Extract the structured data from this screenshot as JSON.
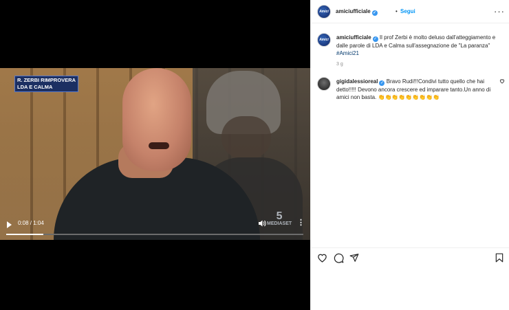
{
  "video": {
    "caption_line1": "R. ZERBI RIMPROVERA",
    "caption_line2": "LDA E CALMA",
    "time": "0:08 / 1:04",
    "progress": 0.125,
    "watermark": "MEDIASET",
    "watermark_num": "5"
  },
  "post": {
    "username": "amiciufficiale",
    "follow_label": "Segui",
    "dot": "•",
    "caption": "Il prof Zerbi è molto deluso dall'atteggiamento e dalle parole di LDA e Calma sull'assegnazione de \"La paranza\"",
    "hashtag": "#Amici21",
    "age": "3 g",
    "avatar_text": "Amici"
  },
  "comments": [
    {
      "username": "gigidalessioreal",
      "text": "Bravo Rudi!!!Condivi tutto quello che hai detto!!!!! Devono ancora crescere ed imparare tanto.Un anno di amici non basta. 👏👏👏👏👏👏👏👏👏"
    }
  ],
  "icons": {
    "like": "heart-icon",
    "comment": "comment-icon",
    "share": "share-icon",
    "save": "bookmark-icon",
    "more": "more-icon",
    "play": "play-icon",
    "volume": "volume-icon"
  }
}
